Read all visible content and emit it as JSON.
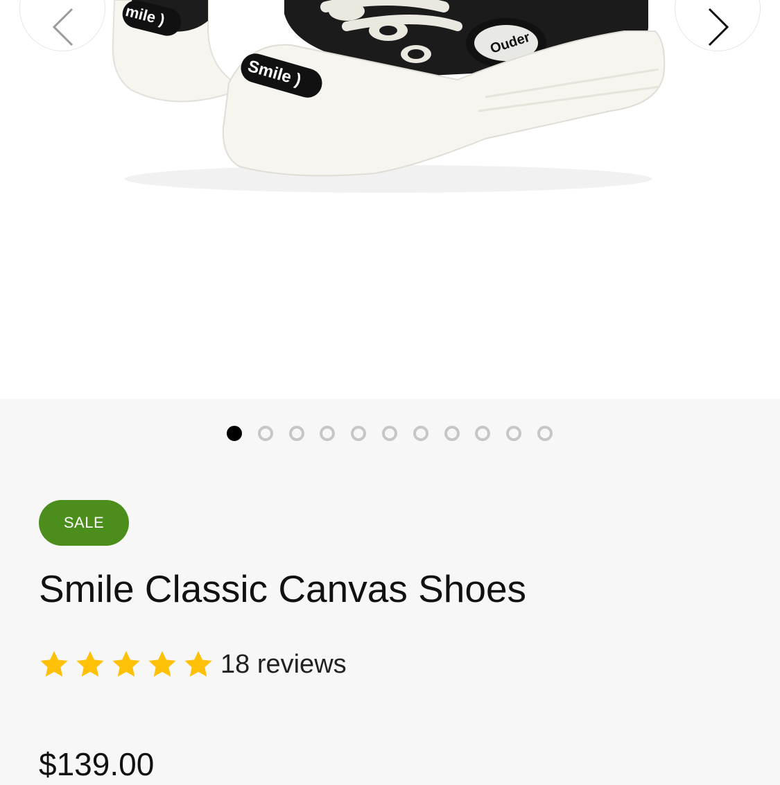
{
  "gallery": {
    "image_alt": "Black canvas sneakers with cream rubber toe caps and chunky laces",
    "shoe_labels": {
      "left_toe": "mile )",
      "right_toe": "Smile )",
      "side_badge": "Ouder"
    },
    "prev_icon": "chevron-left-icon",
    "next_icon": "chevron-right-icon",
    "dot_count": 11,
    "active_dot": 0
  },
  "product": {
    "badge": "SALE",
    "title": "Smile Classic Canvas Shoes",
    "rating": 5,
    "rating_max": 5,
    "reviews": "18 reviews",
    "price": "$139.00"
  },
  "colors": {
    "badge_bg": "#4b8e1c",
    "star": "#ffc107",
    "dot_active": "#000000",
    "dot_inactive": "#c6c6c6",
    "page_bg": "#f7f7f7"
  }
}
